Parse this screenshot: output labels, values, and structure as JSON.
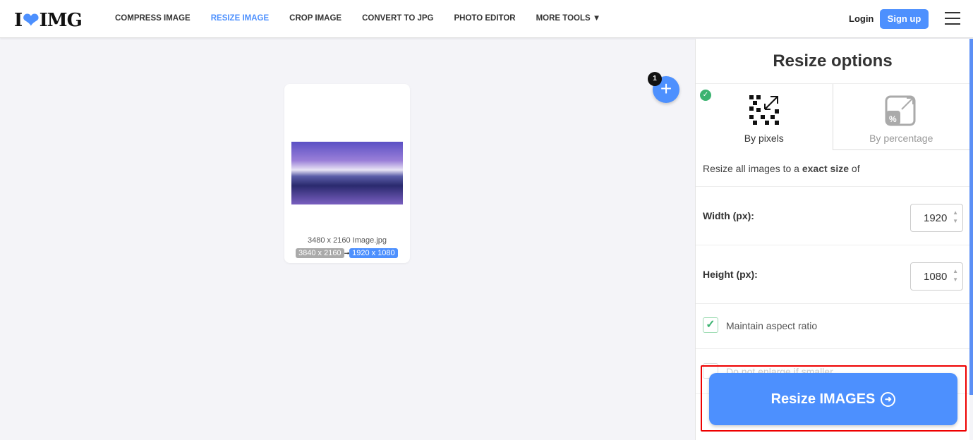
{
  "header": {
    "logo": "I❤IMG",
    "nav": [
      "COMPRESS IMAGE",
      "RESIZE IMAGE",
      "CROP IMAGE",
      "CONVERT TO JPG",
      "PHOTO EDITOR",
      "MORE TOOLS"
    ],
    "login": "Login",
    "signup": "Sign up"
  },
  "file": {
    "name": "3480 x 2160 Image.jpg",
    "original_size": "3840 x 2160",
    "new_size": "1920 x 1080",
    "count": "1"
  },
  "panel": {
    "title": "Resize options",
    "tab_pixels": "By pixels",
    "tab_percentage": "By percentage",
    "desc_pre": "Resize all images to a ",
    "desc_bold": "exact size",
    "desc_post": " of",
    "width_label": "Width (px):",
    "width_value": "1920",
    "height_label": "Height (px):",
    "height_value": "1080",
    "maintain_aspect": "Maintain aspect ratio",
    "maintain_checked": true,
    "no_enlarge": "Do not enlarge if smaller",
    "button": "Resize IMAGES"
  },
  "colors": {
    "accent": "#4d90fe",
    "highlight": "#e00000"
  }
}
